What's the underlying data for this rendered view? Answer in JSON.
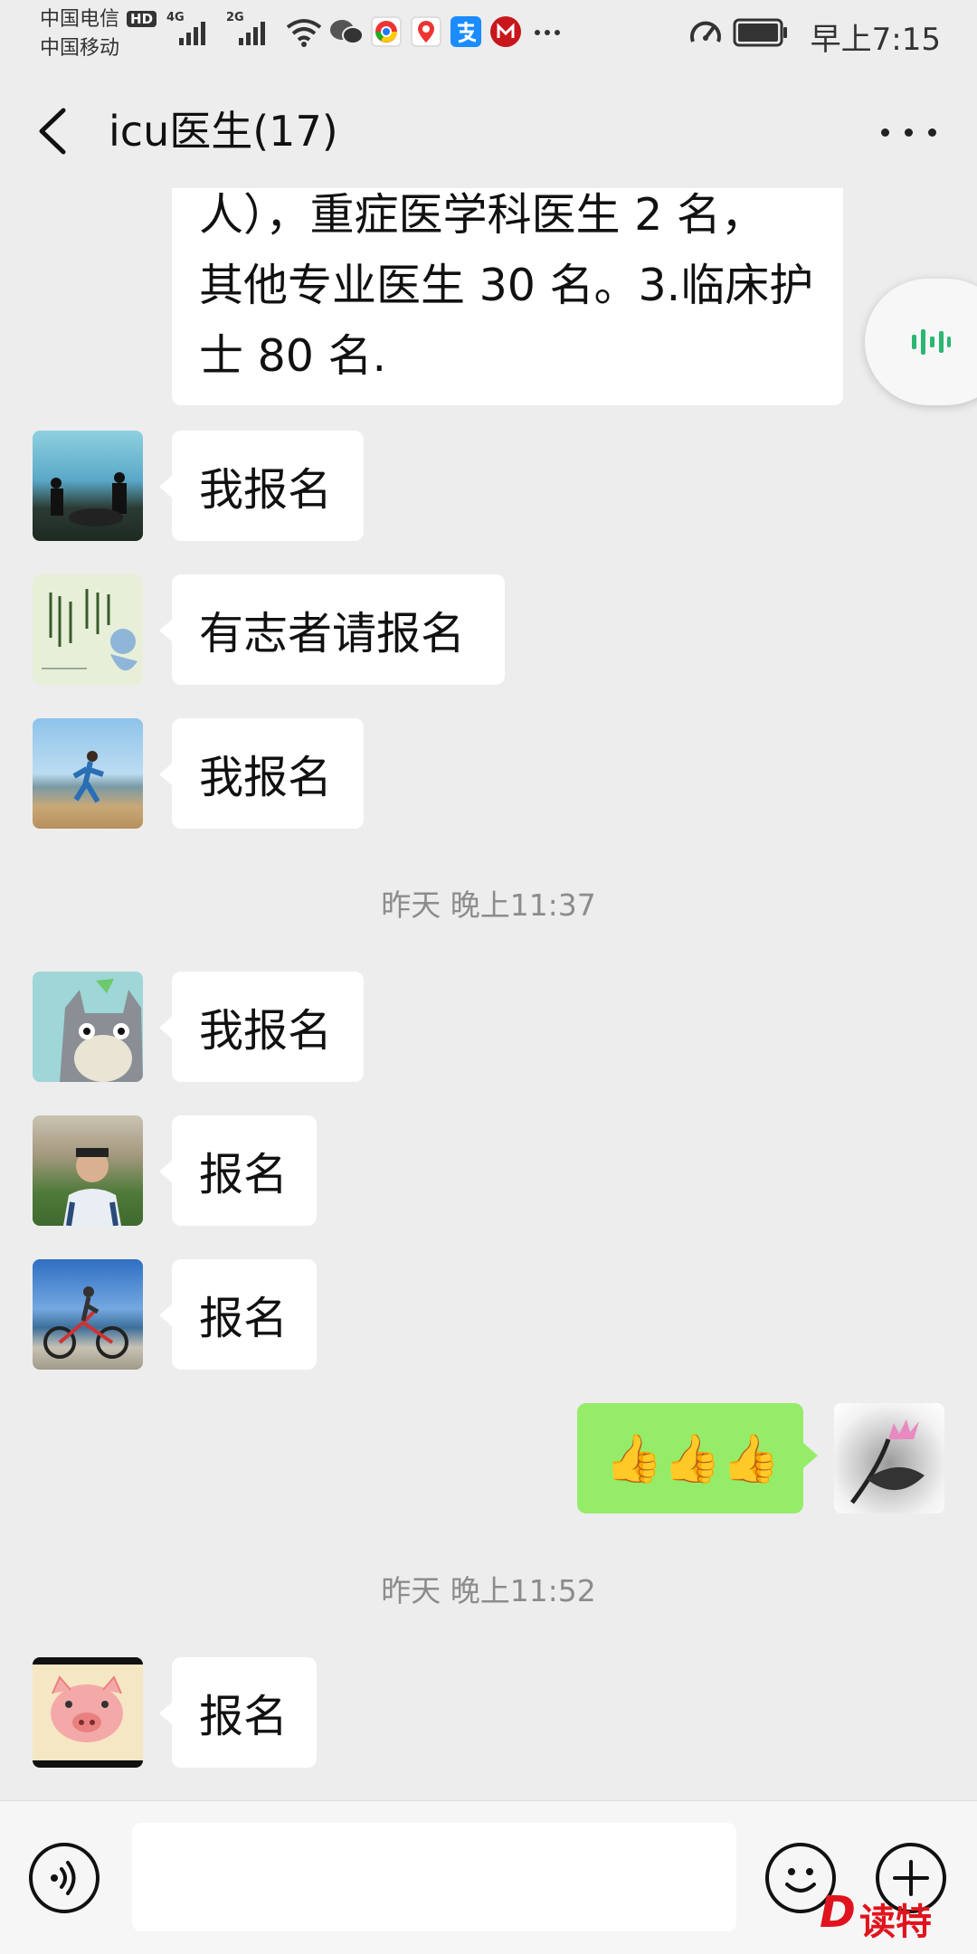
{
  "status_bar": {
    "carrier_1": "中国电信",
    "carrier_1_badge": "HD",
    "carrier_2": "中国移动",
    "signal_1_type": "4G",
    "signal_2_type": "2G",
    "time": "早上7:15",
    "icons": [
      "wifi-icon",
      "wechat-icon",
      "chrome-icon",
      "maps-pin-icon",
      "alipay-icon",
      "metro-icon",
      "more-dots-icon",
      "speed-icon",
      "battery-icon"
    ]
  },
  "header": {
    "back_icon": "chevron-left-icon",
    "title": "icu医生(17)",
    "more_icon": "more-horizontal-icon"
  },
  "chat": {
    "top_message_lines": [
      "人），重症医学科医生 2 名，",
      "其他专业医生 30 名。3.临床护",
      "士 80 名."
    ],
    "messages": [
      {
        "text": "我报名"
      },
      {
        "text": "有志者请报名"
      },
      {
        "text": "我报名"
      },
      {
        "timestamp": "昨天 晚上11:37"
      },
      {
        "text": "我报名"
      },
      {
        "text": "报名"
      },
      {
        "text": "报名"
      },
      {
        "text": "👍👍👍"
      },
      {
        "timestamp": "昨天 晚上11:52"
      },
      {
        "text": "报名"
      }
    ]
  },
  "input_bar": {
    "voice_icon": "voice-icon",
    "emoji_icon": "emoji-icon",
    "plus_icon": "plus-icon",
    "input_value": ""
  },
  "watermark": {
    "logo_letter": "D",
    "logo_text": "读特"
  },
  "colors": {
    "background": "#ededed",
    "outgoing_bubble": "#95ec69",
    "incoming_bubble": "#ffffff",
    "timestamp_text": "#8c8c8c",
    "voice_float_accent": "#2bb673",
    "watermark": "#e0141e"
  }
}
